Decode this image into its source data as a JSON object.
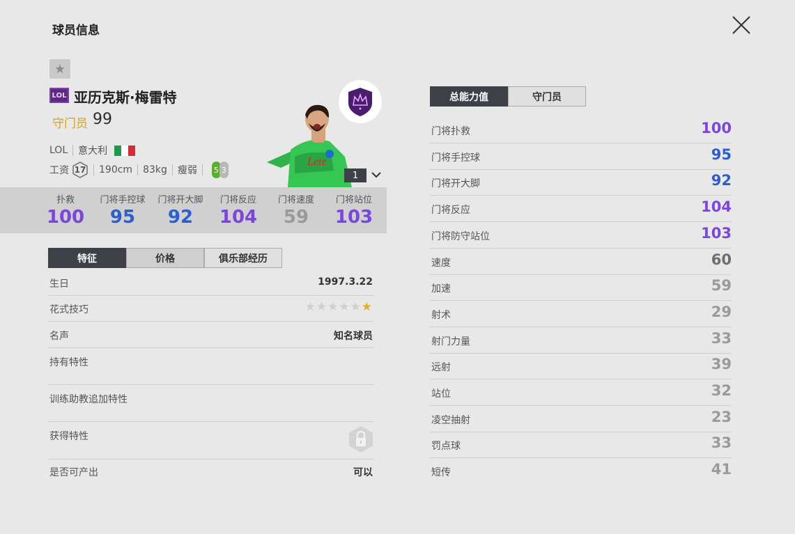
{
  "page_title": "球员信息",
  "player": {
    "season_badge": "LOL",
    "name": "亚历克斯·梅雷特",
    "position": "守门员",
    "overall": "99",
    "season": "LOL",
    "nationality": "意大利",
    "salary_label": "工资",
    "salary": "17",
    "height": "190cm",
    "weight": "83kg",
    "body_type": "瘦弱",
    "weak_foot_left": "5",
    "weak_foot_right": "3",
    "level": "1"
  },
  "summary_stats": [
    {
      "label": "扑救",
      "value": "100",
      "color": "#7b45e0"
    },
    {
      "label": "门将手控球",
      "value": "95",
      "color": "#2b5fd1"
    },
    {
      "label": "门将开大脚",
      "value": "92",
      "color": "#2b5fd1"
    },
    {
      "label": "门将反应",
      "value": "104",
      "color": "#7b45e0"
    },
    {
      "label": "门将速度",
      "value": "59",
      "color": "#9a9a9a"
    },
    {
      "label": "门将站位",
      "value": "103",
      "color": "#7b45e0"
    }
  ],
  "left_tabs": [
    "特征",
    "价格",
    "俱乐部经历"
  ],
  "info": {
    "birthday_label": "生日",
    "birthday": "1997.3.22",
    "skill_label": "花式技巧",
    "skill_stars": 1,
    "fame_label": "名声",
    "fame": "知名球员",
    "traits_label": "持有特性",
    "coach_traits_label": "训练助教追加特性",
    "acquired_traits_label": "获得特性",
    "tradable_label": "是否可产出",
    "tradable": "可以"
  },
  "right_tabs": [
    "总能力值",
    "守门员"
  ],
  "attributes": [
    {
      "label": "门将扑救",
      "value": "100",
      "color": "#7b45e0"
    },
    {
      "label": "门将手控球",
      "value": "95",
      "color": "#2b5fd1"
    },
    {
      "label": "门将开大脚",
      "value": "92",
      "color": "#2b5fd1"
    },
    {
      "label": "门将反应",
      "value": "104",
      "color": "#7b45e0"
    },
    {
      "label": "门将防守站位",
      "value": "103",
      "color": "#7b45e0"
    },
    {
      "label": "速度",
      "value": "60",
      "color": "#6e6e6e"
    },
    {
      "label": "加速",
      "value": "59",
      "color": "#9a9a9a"
    },
    {
      "label": "射术",
      "value": "29",
      "color": "#9a9a9a"
    },
    {
      "label": "射门力量",
      "value": "33",
      "color": "#9a9a9a"
    },
    {
      "label": "远射",
      "value": "39",
      "color": "#9a9a9a"
    },
    {
      "label": "站位",
      "value": "32",
      "color": "#9a9a9a"
    },
    {
      "label": "凌空抽射",
      "value": "23",
      "color": "#9a9a9a"
    },
    {
      "label": "罚点球",
      "value": "33",
      "color": "#9a9a9a"
    },
    {
      "label": "短传",
      "value": "41",
      "color": "#9a9a9a"
    }
  ]
}
